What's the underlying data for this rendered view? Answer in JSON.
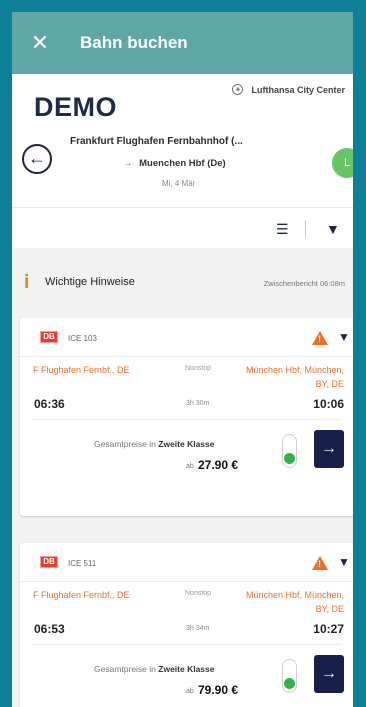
{
  "appbar": {
    "close_label": "✕",
    "title": "Bahn buchen"
  },
  "brand": {
    "logo_text": "DEMO",
    "partner": "Lufthansa City Center",
    "partner_mark": "⚹"
  },
  "route": {
    "from": "Frankfurt Flughafen Fernbahnhof (...",
    "to_arrow": "→",
    "to": "Muenchen Hbf (De)",
    "date": "Mi, 4 Mär",
    "avatar": "L"
  },
  "filters": {
    "sort_icon": "☰",
    "filter_icon": "▼"
  },
  "notice": {
    "icon": "i",
    "text": "Wichtige Hinweise",
    "timestamp": "Zwischenbericht 06:08m"
  },
  "cards": [
    {
      "operator": "DB",
      "train": "ICE 103",
      "warning": "!",
      "from": "F Flughafen Fernbf., DE",
      "direction": "Nonstop",
      "to": "München Hbf, München, BY, DE",
      "dep": "06:36",
      "duration": "3h 30m",
      "arr": "10:06",
      "price_label_prefix": "Gesamtpreise in",
      "price_label_class": "Zweite Klasse",
      "price_from": "ab",
      "price": "27.90 €",
      "go": "→"
    },
    {
      "operator": "DB",
      "train": "ICE 511",
      "warning": "!",
      "from": "F Flughafen Fernbf., DE",
      "direction": "Nonstop",
      "to": "München Hbf, München, BY, DE",
      "dep": "06:53",
      "duration": "3h 34m",
      "arr": "10:27",
      "price_label_prefix": "Gesamtpreise in",
      "price_label_class": "Zweite Klasse",
      "price_from": "ab",
      "price": "79.90 €",
      "go": "→"
    }
  ],
  "colors": {
    "frame": "#0d7f96",
    "appbar": "#5fa7a7",
    "db_red": "#ef3b32",
    "station_orange": "#f06e2c",
    "navy": "#18204a",
    "toggle_green": "#34b24a"
  }
}
